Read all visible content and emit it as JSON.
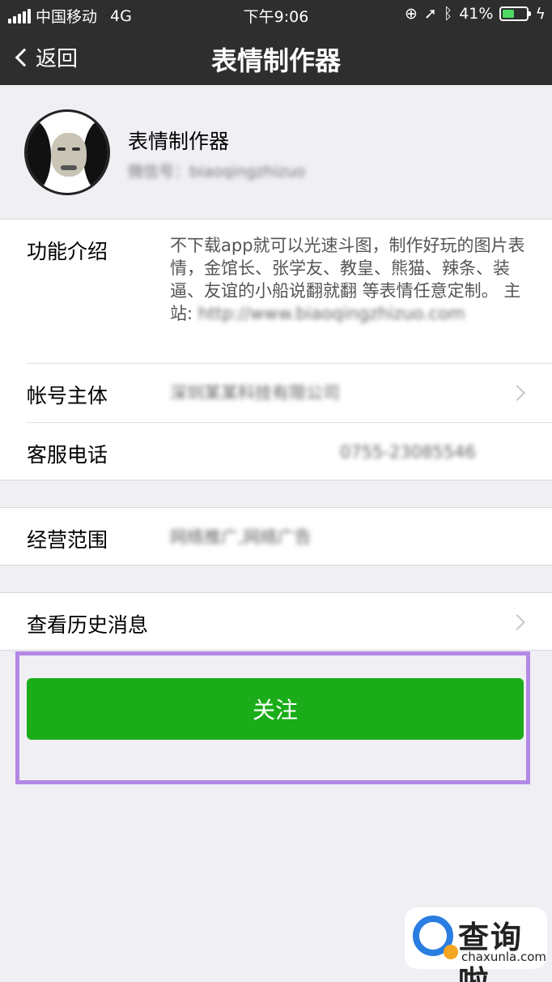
{
  "status_bar": {
    "carrier": "中国移动",
    "network": "4G",
    "time": "下午9:06",
    "battery": "41%",
    "battery_level": 0.41
  },
  "nav": {
    "back_label": "返回",
    "title": "表情制作器"
  },
  "profile": {
    "name": "表情制作器",
    "wechat_id": "微信号：biaoqingzhizuo"
  },
  "info": {
    "intro_label": "功能介绍",
    "intro_text": "不下载app就可以光速斗图，制作好玩的图片表情，金馆长、张学友、教皇、熊猫、辣条、装逼、友谊的小船说翻就翻 等表情任意定制。 主站: ",
    "intro_url": "http://www.biaoqingzhizuo.com",
    "entity_label": "帐号主体",
    "entity_value": "深圳某某科技有限公司",
    "phone_label": "客服电话",
    "phone_value": "0755-23085546"
  },
  "business": {
    "label": "经营范围",
    "value": "网络推广,网络广告"
  },
  "history": {
    "label": "查看历史消息"
  },
  "follow": {
    "label": "关注"
  },
  "watermark": {
    "cn": "查询啦",
    "en": "chaxunla.com"
  },
  "colors": {
    "follow_button": "#1aad19",
    "highlight_border": "#b388e6",
    "nav_background": "#2e2e2e"
  }
}
